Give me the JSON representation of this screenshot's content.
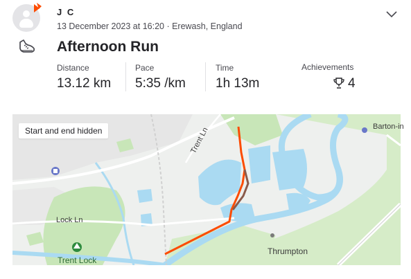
{
  "athlete": {
    "name": "J C"
  },
  "activity": {
    "meta": "13 December 2023 at 16:20 · Erewash, England",
    "title": "Afternoon Run",
    "type_icon": "running-shoe-icon"
  },
  "stats": [
    {
      "label": "Distance",
      "value": "13.12 km"
    },
    {
      "label": "Pace",
      "value": "5:35 /km"
    },
    {
      "label": "Time",
      "value": "1h 13m"
    }
  ],
  "achievements": {
    "label": "Achievements",
    "count": "4",
    "icon": "trophy-icon"
  },
  "map": {
    "notice": "Start and end hidden",
    "labels": {
      "trent_ln": "Trent Ln",
      "lock_ln": "Lock Ln",
      "thrumpton": "Thrumpton",
      "barton": "Barton-in",
      "trent_lock": "Trent Lock"
    }
  },
  "colors": {
    "route": "#fc4c02",
    "route_overlap": "#8a5a4a",
    "water": "#aadaf2",
    "park": "#c8e6b8",
    "brand": "#fc4c02"
  }
}
